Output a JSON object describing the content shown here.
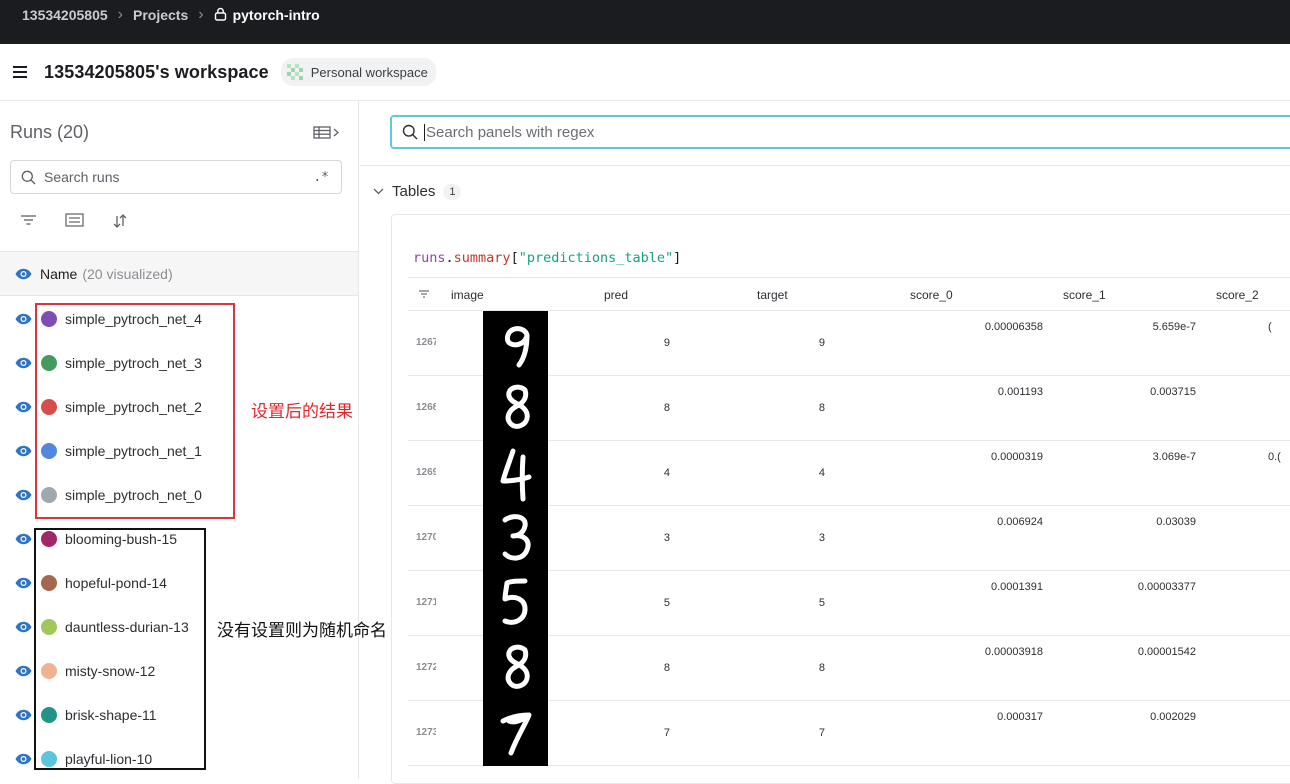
{
  "topbar": {
    "user": "13534205805",
    "projects": "Projects",
    "project": "pytorch-intro"
  },
  "workspace": {
    "title": "13534205805's workspace",
    "badge": "Personal workspace"
  },
  "runs_panel": {
    "title": "Runs (20)",
    "search_placeholder": "Search runs",
    "regex_label": ".*",
    "name_header": "Name",
    "visualized": "(20 visualized)",
    "runs": [
      {
        "name": "simple_pytroch_net_4",
        "color": "#7e4fb3"
      },
      {
        "name": "simple_pytroch_net_3",
        "color": "#479a5f"
      },
      {
        "name": "simple_pytroch_net_2",
        "color": "#da4c4c"
      },
      {
        "name": "simple_pytroch_net_1",
        "color": "#5387dd"
      },
      {
        "name": "simple_pytroch_net_0",
        "color": "#a0a7ad"
      },
      {
        "name": "blooming-bush-15",
        "color": "#a12864"
      },
      {
        "name": "hopeful-pond-14",
        "color": "#a46750"
      },
      {
        "name": "dauntless-durian-13",
        "color": "#a0c75c"
      },
      {
        "name": "misty-snow-12",
        "color": "#efb392"
      },
      {
        "name": "brisk-shape-11",
        "color": "#229487"
      },
      {
        "name": "playful-lion-10",
        "color": "#5bc5db"
      }
    ]
  },
  "annotations": {
    "red_note": "设置后的结果",
    "black_note": "没有设置则为随机命名"
  },
  "main": {
    "search_placeholder": "Search panels with regex",
    "section": {
      "title": "Tables",
      "count": "1"
    },
    "expression": {
      "part1": "runs",
      "part2": ".",
      "part3": "summary",
      "part4": "[",
      "part5": "\"predictions_table\"",
      "part6": "]"
    },
    "table": {
      "columns": [
        "image",
        "pred",
        "target",
        "score_0",
        "score_1",
        "score_2"
      ],
      "rows": [
        {
          "idx": "1267",
          "digit": "9",
          "pred": "9",
          "target": "9",
          "score_0": "0.00006358",
          "score_1": "5.659e-7",
          "score_2": "("
        },
        {
          "idx": "1268",
          "digit": "8",
          "pred": "8",
          "target": "8",
          "score_0": "0.001193",
          "score_1": "0.003715",
          "score_2": ""
        },
        {
          "idx": "1269",
          "digit": "4",
          "pred": "4",
          "target": "4",
          "score_0": "0.0000319",
          "score_1": "3.069e-7",
          "score_2": "0.("
        },
        {
          "idx": "1270",
          "digit": "3",
          "pred": "3",
          "target": "3",
          "score_0": "0.006924",
          "score_1": "0.03039",
          "score_2": ""
        },
        {
          "idx": "1271",
          "digit": "5",
          "pred": "5",
          "target": "5",
          "score_0": "0.0001391",
          "score_1": "0.00003377",
          "score_2": ""
        },
        {
          "idx": "1272",
          "digit": "8",
          "pred": "8",
          "target": "8",
          "score_0": "0.00003918",
          "score_1": "0.00001542",
          "score_2": ""
        },
        {
          "idx": "1273",
          "digit": "7",
          "pred": "7",
          "target": "7",
          "score_0": "0.000317",
          "score_1": "0.002029",
          "score_2": ""
        }
      ]
    }
  }
}
